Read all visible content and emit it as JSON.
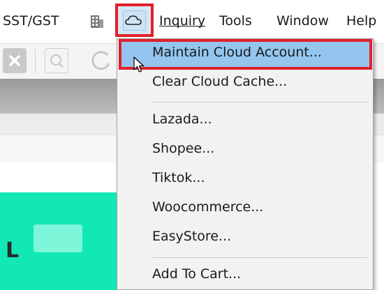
{
  "menubar": {
    "items": [
      {
        "label": "SST/GST"
      },
      {
        "label": "Inquiry"
      },
      {
        "label": "Tools"
      },
      {
        "label": "Window"
      },
      {
        "label": "Help"
      }
    ],
    "icons": [
      "building-icon",
      "cloud-icon"
    ]
  },
  "toolbar": {
    "icons": [
      "close-icon",
      "search-icon",
      "refresh-icon"
    ]
  },
  "dropdown": {
    "items": [
      {
        "label": "Maintain Cloud Account...",
        "highlighted": true
      },
      {
        "label": "Clear Cloud Cache..."
      },
      {
        "label": "Lazada..."
      },
      {
        "label": "Shopee..."
      },
      {
        "label": "Tiktok..."
      },
      {
        "label": "Woocommerce..."
      },
      {
        "label": "EasyStore..."
      },
      {
        "label": "Add To Cart..."
      }
    ]
  },
  "background": {
    "panel_letter": "L"
  },
  "colors": {
    "highlight": "#94c5ee",
    "annotation_border": "#e0202b",
    "teal_panel": "#11e8b6",
    "menu_bg": "#f2f2f2"
  }
}
